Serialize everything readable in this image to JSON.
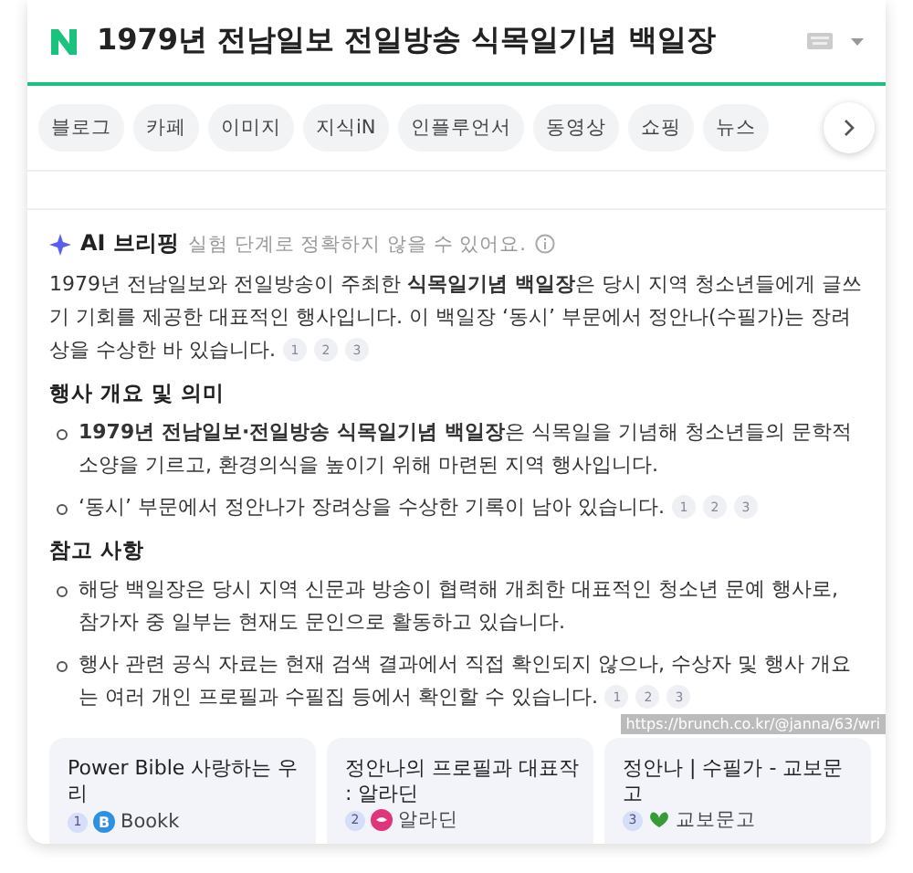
{
  "search": {
    "query": "1979년 전남일보 전일방송 식목일기념 백일장"
  },
  "tabs": [
    {
      "label": "블로그",
      "selected": false
    },
    {
      "label": "카페",
      "selected": false
    },
    {
      "label": "이미지",
      "selected": false
    },
    {
      "label": "지식iN",
      "selected": false
    },
    {
      "label": "인플루언서",
      "selected": false
    },
    {
      "label": "동영상",
      "selected": false
    },
    {
      "label": "쇼핑",
      "selected": false
    },
    {
      "label": "뉴스",
      "selected": false
    }
  ],
  "briefing": {
    "title": "AI 브리핑",
    "notice": "실험 단계로 정확하지 않을 수 있어요.",
    "summary": {
      "text": "1979년 전남일보와 전일방송이 주최한 **식목일기념 백일장**은 당시 지역 청소년들에게 글쓰기 기회를 제공한 대표적인 행사입니다. 이 백일장 ‘동시’ 부문에서 정안나(수필가)는 장려상을 수상한 바 있습니다.",
      "citations": [
        "1",
        "2",
        "3"
      ]
    },
    "sections": [
      {
        "heading": "행사 개요 및 의미",
        "bullets": [
          {
            "text": "**1979년 전남일보·전일방송 식목일기념 백일장**은 식목일을 기념해 청소년들의 문학적 소양을 기르고, 환경의식을 높이기 위해 마련된 지역 행사입니다."
          },
          {
            "text": "‘동시’ 부문에서 정안나가 장려상을 수상한 기록이 남아 있습니다.",
            "citations": [
              "1",
              "2",
              "3"
            ]
          }
        ]
      },
      {
        "heading": "참고 사항",
        "bullets": [
          {
            "text": "해당 백일장은 당시 지역 신문과 방송이 협력해 개최한 대표적인 청소년 문예 행사로, 참가자 중 일부는 현재도 문인으로 활동하고 있습니다."
          },
          {
            "text": "행사 관련 공식 자료는 현재 검색 결과에서 직접 확인되지 않으나, 수상자 및 행사 개요는 여러 개인 프로필과 수필집 등에서 확인할 수 있습니다.",
            "citations": [
              "1",
              "2",
              "3"
            ]
          }
        ]
      }
    ],
    "sources": [
      {
        "title": "Power Bible 사랑하는 우리",
        "number": "1",
        "site": "Bookk",
        "kind": "letter",
        "logo": "B",
        "color": "#2f8fe0"
      },
      {
        "title": "정안나의 프로필과 대표작 : 알라딘",
        "number": "2",
        "site": "알라딘",
        "kind": "bird",
        "color": "#e0357a"
      },
      {
        "title": "정안나 | 수필가 - 교보문고",
        "number": "3",
        "site": "교보문고",
        "kind": "leaf",
        "color": "#3a9a3a"
      }
    ],
    "link_preview": "https://brunch.co.kr/@janna/63/wri"
  }
}
